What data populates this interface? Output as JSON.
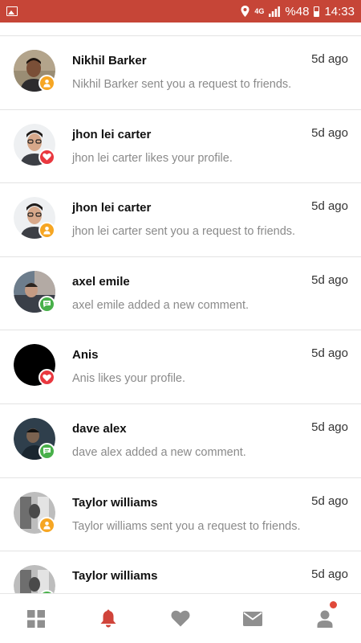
{
  "status_bar": {
    "network": "4G",
    "battery": "%48",
    "time": "14:33"
  },
  "notifications": [
    {
      "name": "Nikhil Barker",
      "message": "Nikhil Barker sent you a request to friends.",
      "time": "5d ago",
      "type": "friend",
      "avatar": "a1"
    },
    {
      "name": "jhon lei carter",
      "message": "jhon lei carter likes your profile.",
      "time": "5d ago",
      "type": "like",
      "avatar": "a2"
    },
    {
      "name": "jhon lei carter",
      "message": "jhon lei carter sent you a request to friends.",
      "time": "5d ago",
      "type": "friend",
      "avatar": "a2"
    },
    {
      "name": "axel emile",
      "message": "axel emile added a new comment.",
      "time": "5d ago",
      "type": "comment",
      "avatar": "a3"
    },
    {
      "name": "Anis",
      "message": "Anis likes your profile.",
      "time": "5d ago",
      "type": "like",
      "avatar": "a4"
    },
    {
      "name": "dave alex",
      "message": "dave alex added a new comment.",
      "time": "5d ago",
      "type": "comment",
      "avatar": "a5"
    },
    {
      "name": "Taylor williams",
      "message": "Taylor williams sent you a request to friends.",
      "time": "5d ago",
      "type": "friend",
      "avatar": "a6"
    },
    {
      "name": "Taylor williams",
      "message": "",
      "time": "5d ago",
      "type": "comment",
      "avatar": "a6"
    }
  ],
  "bottom_nav": [
    {
      "icon": "grid-icon",
      "active": false
    },
    {
      "icon": "bell-icon",
      "active": true
    },
    {
      "icon": "heart-icon",
      "active": false
    },
    {
      "icon": "mail-icon",
      "active": false
    },
    {
      "icon": "profile-icon",
      "active": false,
      "dot": true
    }
  ],
  "colors": {
    "accent": "#c64537",
    "friend": "#f6a623",
    "like": "#e9383f",
    "comment": "#48b04a",
    "nav_inactive": "#8f8f8f",
    "nav_active": "#d0443a"
  }
}
